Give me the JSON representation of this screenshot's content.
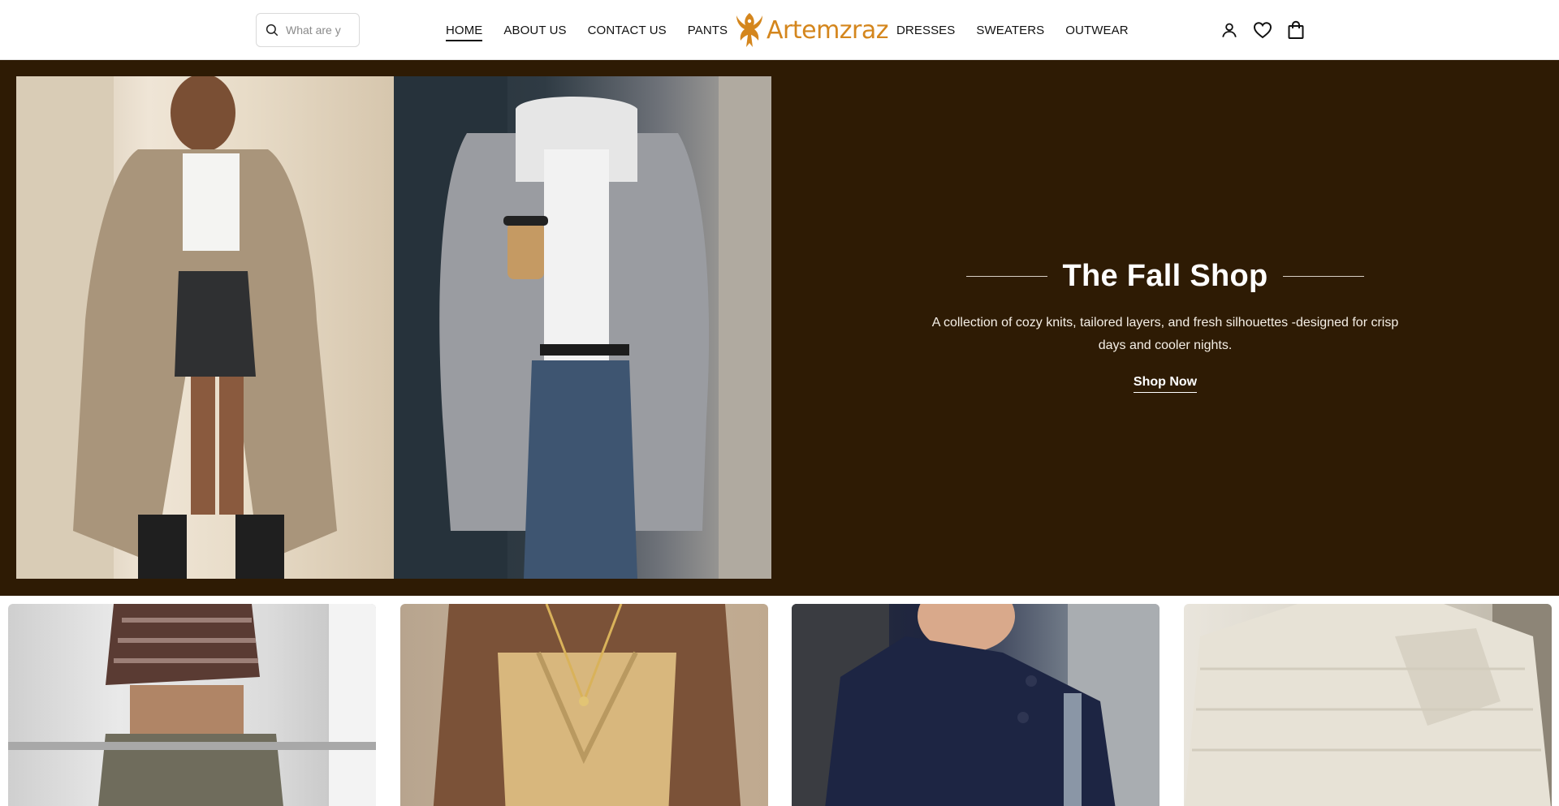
{
  "search": {
    "placeholder": "What are y",
    "icon": "search-icon"
  },
  "nav": {
    "left": [
      "HOME",
      "ABOUT US",
      "CONTACT US",
      "PANTS"
    ],
    "right": [
      "DRESSES",
      "SWEATERS",
      "OUTWEAR"
    ],
    "active": "HOME"
  },
  "brand": {
    "name": "Artemzraz",
    "color": "#d4861d",
    "logo_icon": "phoenix-logo-icon"
  },
  "header_icons": [
    "account-icon",
    "wishlist-heart-icon",
    "shopping-bag-icon"
  ],
  "hero": {
    "title": "The Fall Shop",
    "description": "A collection of cozy knits, tailored layers, and fresh silhouettes -designed for crisp days and cooler nights.",
    "cta": "Shop Now",
    "background_color": "#2e1b04",
    "images": [
      "trench-coat-outfit-photo",
      "grey-zip-hoodie-outfit-photo"
    ]
  },
  "product_tiles": [
    "plaid-corset-top-photo",
    "satin-cowl-top-photo",
    "navy-wool-coat-photo",
    "cream-knit-sweater-photo"
  ]
}
